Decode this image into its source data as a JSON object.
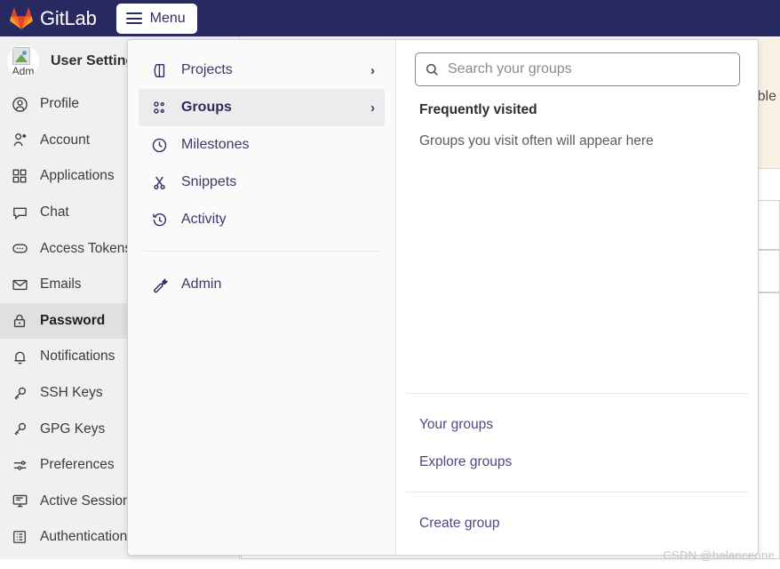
{
  "navbar": {
    "brand": "GitLab",
    "logo_icon": "gitlab-tanuki-icon",
    "logo_colors": {
      "light": "#FC6D26",
      "dark": "#E24329",
      "mid": "#FCA326"
    },
    "menu_button": {
      "label": "Menu",
      "icon": "hamburger-icon"
    },
    "background": "#292961"
  },
  "settings_sidebar": {
    "avatar": {
      "icon": "broken-image-icon",
      "alt_text": "Adm"
    },
    "title": "User Settings",
    "items": [
      {
        "label": "Profile",
        "icon": "user-circle-icon",
        "active": false
      },
      {
        "label": "Account",
        "icon": "account-icon",
        "active": false
      },
      {
        "label": "Applications",
        "icon": "grid-apps-icon",
        "active": false
      },
      {
        "label": "Chat",
        "icon": "chat-bubble-icon",
        "active": false
      },
      {
        "label": "Access Tokens",
        "icon": "token-icon",
        "active": false
      },
      {
        "label": "Emails",
        "icon": "envelope-icon",
        "active": false
      },
      {
        "label": "Password",
        "icon": "lock-icon",
        "active": true
      },
      {
        "label": "Notifications",
        "icon": "bell-icon",
        "active": false
      },
      {
        "label": "SSH Keys",
        "icon": "key-icon",
        "active": false
      },
      {
        "label": "GPG Keys",
        "icon": "key-icon",
        "active": false
      },
      {
        "label": "Preferences",
        "icon": "sliders-icon",
        "active": false
      },
      {
        "label": "Active Sessions",
        "icon": "monitor-icon",
        "active": false
      },
      {
        "label": "Authentication log",
        "icon": "list-table-icon",
        "active": false
      }
    ]
  },
  "background_alert": {
    "visible_text": "able",
    "trailing_dot": ".",
    "color": "#FAF1E5"
  },
  "dropdown": {
    "left_menu": {
      "items": [
        {
          "label": "Projects",
          "icon": "projects-icon",
          "chevron": "›",
          "selected": false
        },
        {
          "label": "Groups",
          "icon": "groups-icon",
          "chevron": "›",
          "selected": true
        },
        {
          "label": "Milestones",
          "icon": "clock-icon",
          "chevron": "",
          "selected": false
        },
        {
          "label": "Snippets",
          "icon": "scissors-icon",
          "chevron": "",
          "selected": false
        },
        {
          "label": "Activity",
          "icon": "history-icon",
          "chevron": "",
          "selected": false
        }
      ],
      "admin_item": {
        "label": "Admin",
        "icon": "wrench-icon"
      }
    },
    "right_pane": {
      "search": {
        "placeholder": "Search your groups",
        "value": "",
        "icon": "search-icon"
      },
      "frequently_visited_title": "Frequently visited",
      "frequently_visited_empty": "Groups you visit often will appear here",
      "links_primary": [
        {
          "label": "Your groups"
        },
        {
          "label": "Explore groups"
        }
      ],
      "links_secondary": [
        {
          "label": "Create group"
        }
      ]
    },
    "highlight_color": "#ECECEF",
    "text_color": "#3A3A68"
  },
  "watermark": {
    "text": "CSDN @balanceone"
  }
}
